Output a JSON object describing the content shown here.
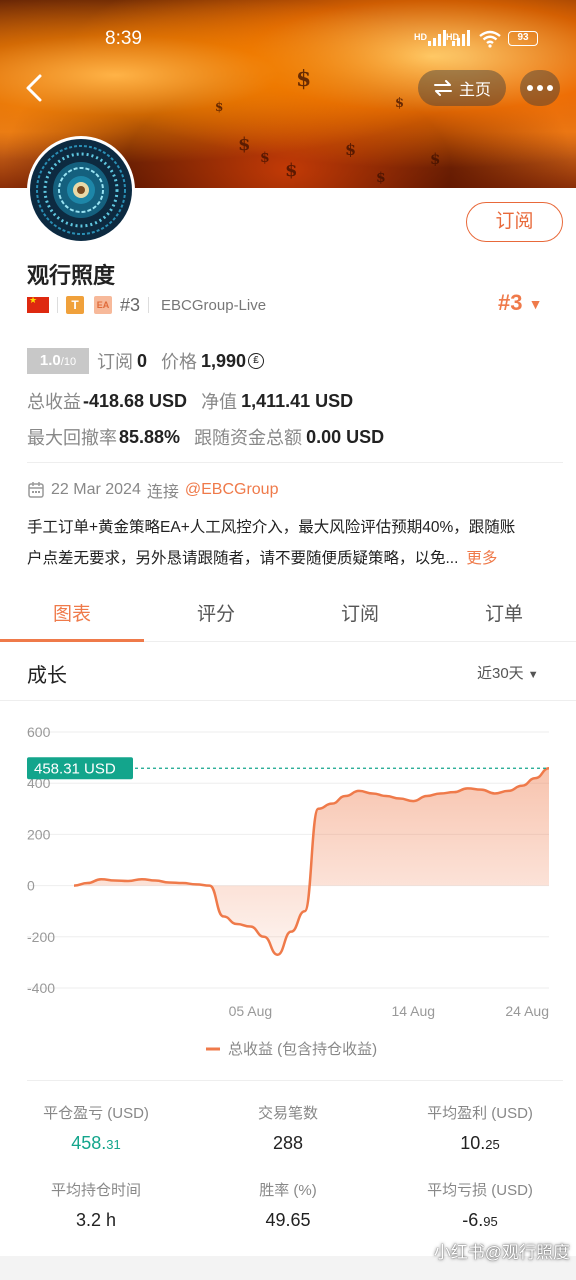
{
  "status_bar": {
    "time": "8:39",
    "network_1": "HD",
    "network_2": "HD",
    "battery": "93"
  },
  "header": {
    "home_label": "主页"
  },
  "profile": {
    "name": "观行照度",
    "subscribe_label": "订阅",
    "badge_t": "T",
    "badge_ea": "EA",
    "rank_small": "#3",
    "group": "EBCGroup-Live",
    "rank_big": "#3"
  },
  "stats": {
    "rating": "1.0",
    "rating_max": "/10",
    "subscribers_label": "订阅",
    "subscribers_value": "0",
    "price_label": "价格",
    "price_value": "1,990",
    "price_coin": "₤",
    "total_profit_label": "总收益",
    "total_profit_value": "-418.68 USD",
    "net_value_label": "净值",
    "net_value_value": "1,411.41 USD",
    "max_drawdown_label": "最大回撤率",
    "max_drawdown_value": "85.88%",
    "follow_funds_label": "跟随资金总额",
    "follow_funds_value": "0.00 USD"
  },
  "meta": {
    "date": "22 Mar 2024",
    "connect_label": "连接",
    "handle": "@EBCGroup"
  },
  "description": {
    "line1": "手工订单+黄金策略EA+人工风控介入，最大风险评估预期40%，跟随账",
    "line2": "户点差无要求，另外恳请跟随者，请不要随便质疑策略，以免...",
    "more": "更多"
  },
  "tabs": [
    "图表",
    "评分",
    "订阅",
    "订单"
  ],
  "growth": {
    "title": "成长",
    "range": "近30天"
  },
  "chart_data": {
    "type": "area",
    "x_ticks": [
      "05 Aug",
      "14 Aug",
      "24 Aug"
    ],
    "y_ticks": [
      "600",
      "400",
      "200",
      "0",
      "-200",
      "-400"
    ],
    "ylim": [
      -400,
      600
    ],
    "current_value_label": "458.31 USD",
    "current_value": 458.31,
    "legend": "总收益 (包含持仓收益)",
    "series": [
      {
        "values": [
          0,
          10,
          25,
          20,
          18,
          25,
          20,
          12,
          10,
          5,
          0,
          -120,
          -150,
          -160,
          -200,
          -270,
          -180,
          -100,
          300,
          320,
          350,
          370,
          360,
          350,
          340,
          330,
          350,
          360,
          365,
          380,
          375,
          360,
          370,
          390,
          420,
          458.31
        ]
      }
    ],
    "color": "#ef7a4a"
  },
  "summary": [
    {
      "label": "平仓盈亏 (USD)",
      "value_main": "458.",
      "value_small": "31",
      "green": true
    },
    {
      "label": "交易笔数",
      "value_main": "288",
      "value_small": ""
    },
    {
      "label": "平均盈利 (USD)",
      "value_main": "10.",
      "value_small": "25"
    },
    {
      "label": "平均持仓时间",
      "value_main": "3.2 h",
      "value_small": ""
    },
    {
      "label": "胜率 (%)",
      "value_main": "49.65",
      "value_small": ""
    },
    {
      "label": "平均亏损 (USD)",
      "value_main": "-6.",
      "value_small": "95"
    }
  ],
  "watermark": "小红书@观行照度"
}
